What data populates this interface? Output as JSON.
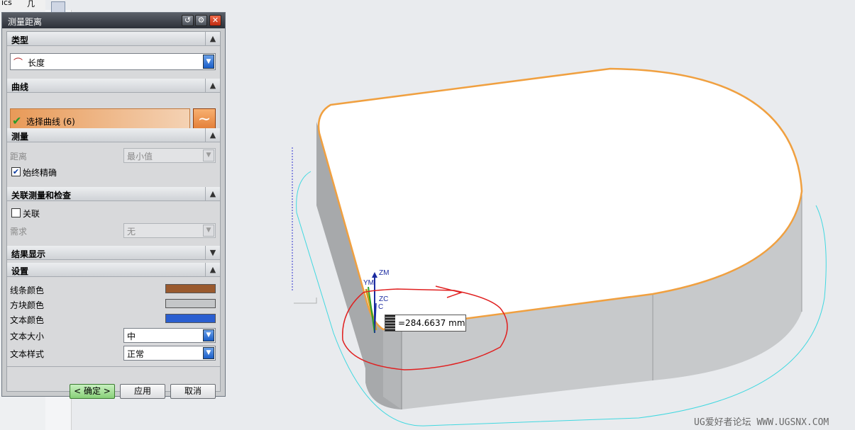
{
  "toolbar": {
    "frag_left": "ics",
    "frag_right": "几"
  },
  "dialog": {
    "title": "测量距离",
    "sections": {
      "type": "类型",
      "curve": "曲线",
      "measure": "测量",
      "assoc": "关联测量和检查",
      "result": "结果显示",
      "settings": "设置"
    },
    "type_value": "长度",
    "curve_select": "选择曲线 (6)",
    "distance_label": "距离",
    "distance_value": "最小值",
    "always_precise": "始终精确",
    "assoc_label": "关联",
    "require_label": "需求",
    "require_value": "无",
    "line_color_label": "线条颜色",
    "block_color_label": "方块颜色",
    "text_color_label": "文本颜色",
    "text_size_label": "文本大小",
    "text_size_value": "中",
    "text_style_label": "文本样式",
    "text_style_value": "正常",
    "ok": "< 确定 >",
    "apply": "应用",
    "cancel": "取消"
  },
  "colors": {
    "line": "#9a5a2e",
    "block": "#c4c6c8",
    "text": "#2a5ed0",
    "edge_highlight": "#f0a040",
    "annotation": "#e02020"
  },
  "viewport": {
    "measure_result": "=284.6637 mm",
    "axis_zm": "ZM",
    "axis_ym": "YM",
    "axis_zc": "ZC",
    "axis_yc": "C",
    "watermark": "UG爱好者论坛 WWW.UGSNX.COM"
  }
}
